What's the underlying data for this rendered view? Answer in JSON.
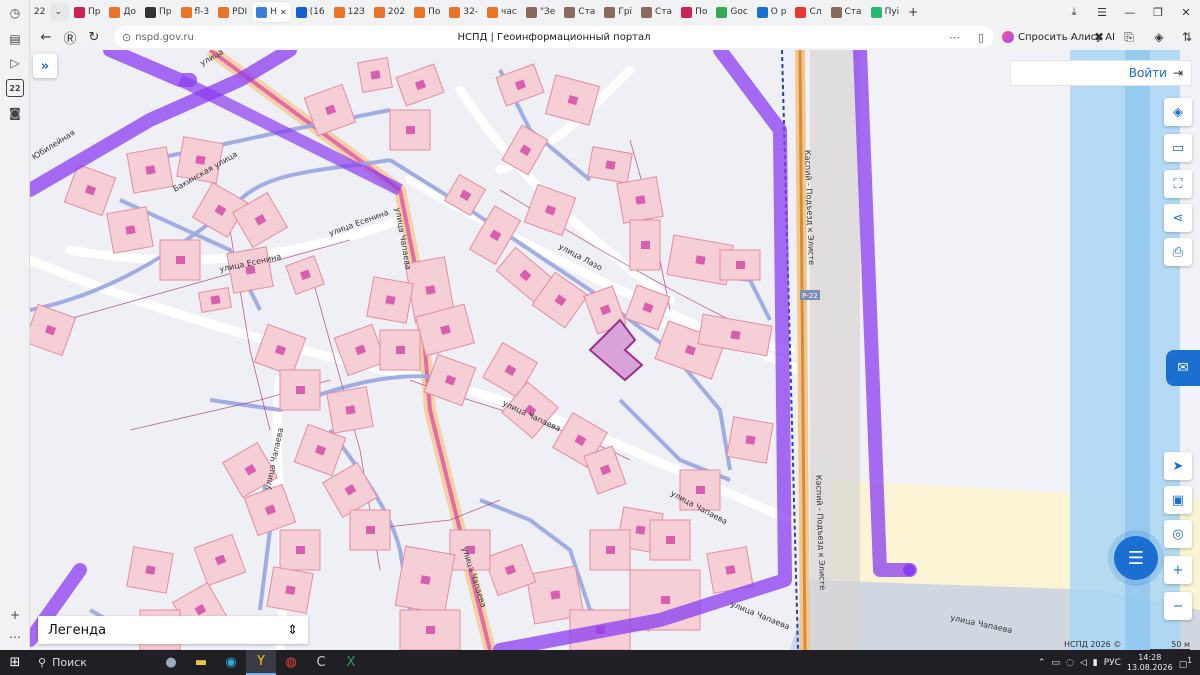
{
  "browser": {
    "tabs": [
      {
        "label": "22",
        "color": "#ffffff"
      },
      {
        "label": "",
        "color": "#e7e8ea",
        "icon": "chevron-down-icon"
      },
      {
        "label": "Пр",
        "color": "#cc2255"
      },
      {
        "label": "До",
        "color": "#e8742a"
      },
      {
        "label": "Пр",
        "color": "#333333"
      },
      {
        "label": "fl-3",
        "color": "#e8742a"
      },
      {
        "label": "PDI",
        "color": "#e8742a"
      },
      {
        "label": "Н",
        "color": "#3a7fd6",
        "active": true
      },
      {
        "label": "(16",
        "color": "#1560d0"
      },
      {
        "label": "12З",
        "color": "#e8742a"
      },
      {
        "label": "202",
        "color": "#e8742a"
      },
      {
        "label": "По",
        "color": "#e8742a"
      },
      {
        "label": "32-",
        "color": "#e8742a"
      },
      {
        "label": "час",
        "color": "#e8742a"
      },
      {
        "label": "\"Зе",
        "color": "#8a6a5a"
      },
      {
        "label": "Ста",
        "color": "#8a6a5a"
      },
      {
        "label": "Грі",
        "color": "#8a6a5a"
      },
      {
        "label": "Ста",
        "color": "#8a6a5a"
      },
      {
        "label": "По",
        "color": "#cc2255"
      },
      {
        "label": "Goc",
        "color": "#34a853"
      },
      {
        "label": "О р",
        "color": "#1a6fd0"
      },
      {
        "label": "Сл",
        "color": "#e53935"
      },
      {
        "label": "Ста",
        "color": "#8a6a5a"
      },
      {
        "label": "Пуі",
        "color": "#2bb673"
      }
    ],
    "new_tab": "+",
    "address_url": "nspd.gov.ru",
    "page_title": "НСПД | Геоинформационный портал",
    "alice_label": "Спросить Алису AI",
    "window": {
      "minimize": "—",
      "restore": "❐",
      "close": "✕"
    }
  },
  "map": {
    "login_label": "Войти",
    "legend_label": "Легенда",
    "copyright": "НСПД 2026 ©",
    "scale_label": "50 м",
    "road_badge": "Р-22",
    "streets": [
      "улица Есенина",
      "улица Есенина",
      "улица Лазо",
      "Бакинская улица",
      "улица Чапаева",
      "улица Чапаева",
      "улица Чапаева",
      "улица Чапаева",
      "улица Чапаева",
      "улица Чапаева",
      "Каспий - Подъезд к Элисте",
      "Каспий - Подъезд к Элисте",
      "улица",
      "Юбилейная",
      "улица Чапаева"
    ],
    "colors": {
      "accent": "#1a6fd0",
      "parcel_fill": "#f6cfd6",
      "parcel_stroke": "#e88a9c",
      "boundary": "#8a3cf0",
      "road_main": "#f0c8a0"
    }
  },
  "taskbar": {
    "search_label": "Поиск",
    "language": "РУС",
    "time": "14:28",
    "date": "13.08.2026",
    "notifications": "1"
  }
}
